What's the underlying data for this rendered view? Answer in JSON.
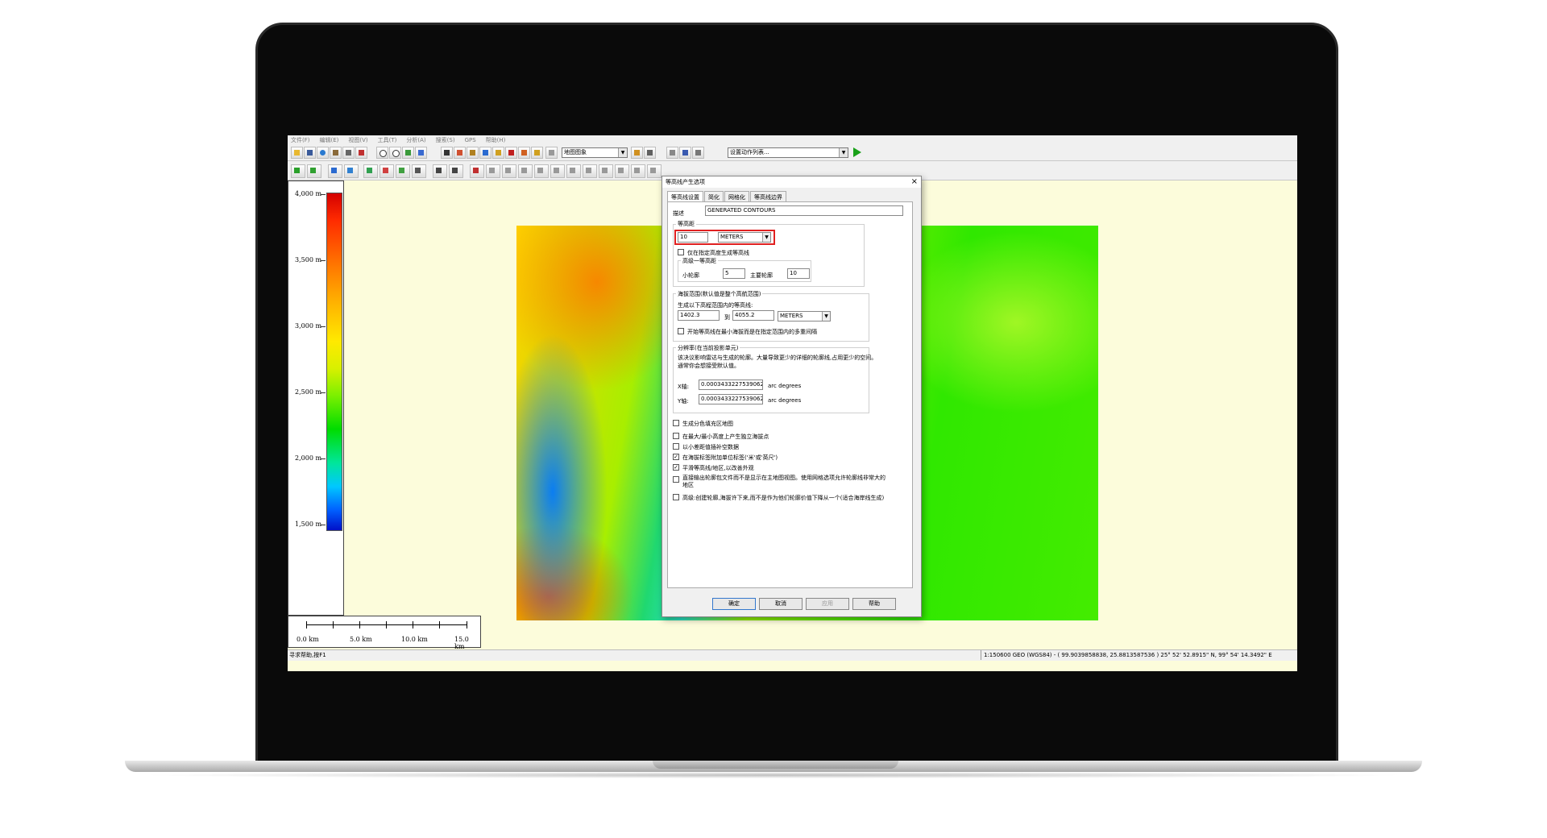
{
  "menubar": [
    "文件(F)",
    "编辑(E)",
    "视图(V)",
    "工具(T)",
    "分析(A)",
    "搜索(S)",
    "GPS",
    "帮助(H)"
  ],
  "toolbar": {
    "layer_combo": "地图图象",
    "script_combo": "设置动作列表..."
  },
  "legend": {
    "ticks": [
      "4,000 m",
      "3,500 m",
      "3,000 m",
      "2,500 m",
      "2,000 m",
      "1,500 m"
    ]
  },
  "scale_bar": {
    "labels": [
      "0.0 km",
      "5.0 km",
      "10.0 km",
      "15.0 km"
    ]
  },
  "dialog": {
    "title": "等高线产生选项",
    "close": "×",
    "tabs": [
      "等高线设置",
      "简化",
      "网格化",
      "等高线边界"
    ],
    "description_label": "描述",
    "description_value": "GENERATED CONTOURS",
    "interval_group": "等高距",
    "interval_value": "10",
    "interval_unit": "METERS",
    "only_specified_label": "仅在指定高度生成等高线",
    "index_group": "高级一等高距",
    "minor_label": "小轮廓",
    "minor_value": "5",
    "major_label": "主要轮廓",
    "major_value": "10",
    "range_group": "海拔范围(默认值是整个高航范围)",
    "range_sublabel": "生成以下高程范围内的等高线:",
    "range_from": "1402.3",
    "range_to_label": "到",
    "range_to": "4055.2",
    "range_unit": "METERS",
    "range_start_label": "开始等高线在最小海拔而是在指定范围内的多重间隔",
    "resolution_group": "分辨率(在当前投影单元)",
    "resolution_text1": "该决议影响雷达与生成的轮廓。大量导致更少的详细的轮廓线,占用更少的空间。",
    "resolution_text2": "通常你会想接受默认值。",
    "x_label": "X轴:",
    "x_value": "0.00034332275390625",
    "x_unit": "arc degrees",
    "y_label": "Y轴:",
    "y_value": "0.00034332275390625",
    "y_unit": "arc degrees",
    "options": [
      {
        "label": "生成分色填充区地图",
        "checked": false
      },
      {
        "label": "在最大/最小高度上产生独立海拔点",
        "checked": false
      },
      {
        "label": "以小差距值插补空数据",
        "checked": false
      },
      {
        "label": "在海拔标签附加单位标签('米'或'英尺')",
        "checked": true
      },
      {
        "label": "平滑等高线/地区,以改善外观",
        "checked": true
      },
      {
        "label": "直接输出轮廓包文件而不是显示在主地图视图。使用网格选项允许轮廓线非常大的",
        "label2": "地区",
        "checked": false
      },
      {
        "label": "高级:创建轮廓,海拔许下来,而不是作为他们轮廓价值下降从一个(适合海岸线生成)",
        "checked": false
      }
    ],
    "buttons": {
      "ok": "确定",
      "cancel": "取消",
      "apply": "应用",
      "help": "帮助"
    },
    "check_mark": "✓"
  },
  "statusbar": {
    "left": "寻求帮助,按F1",
    "right": "1:150600  GEO (WGS84) - ( 99.9039858838, 25.8813587536 )  25° 52' 52.8915\" N, 99° 54' 14.3492\" E"
  }
}
